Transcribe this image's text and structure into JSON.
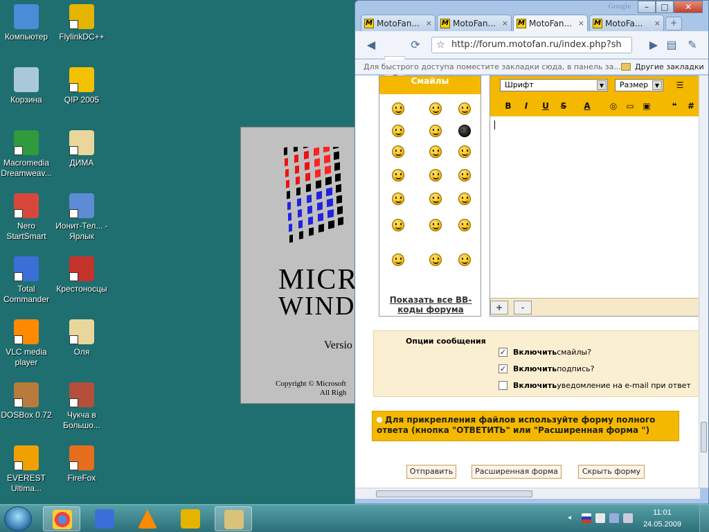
{
  "desktop": {
    "icons": [
      {
        "label": "Компьютер",
        "icon": "computer-icon",
        "color": "#4a8cd8"
      },
      {
        "label": "Корзина",
        "icon": "recycle-bin-icon",
        "color": "#a9c9d9"
      },
      {
        "label": "Macromedia Dreamweav...",
        "icon": "dreamweaver-icon",
        "color": "#2f9b3c"
      },
      {
        "label": "Nero StartSmart",
        "icon": "nero-icon",
        "color": "#d8473c"
      },
      {
        "label": "Total Commander",
        "icon": "floppy-icon",
        "color": "#3b6fd8"
      },
      {
        "label": "VLC media player",
        "icon": "vlc-cone-icon",
        "color": "#ff8a00"
      },
      {
        "label": "DOSBox 0.72",
        "icon": "dosbox-icon",
        "color": "#b97b3c"
      },
      {
        "label": "EVEREST Ultima...",
        "icon": "everest-icon",
        "color": "#f0a000"
      },
      {
        "label": "FlylinkDC++",
        "icon": "flylink-icon",
        "color": "#e4b400"
      },
      {
        "label": "QIP 2005",
        "icon": "qip-icon",
        "color": "#f2c200"
      },
      {
        "label": "ДИМА",
        "icon": "folder-icon",
        "color": "#e9d69a"
      },
      {
        "label": "Ионит-Тел... - Ярлык",
        "icon": "network-icon",
        "color": "#5d8bd4"
      },
      {
        "label": "Крестоносцы",
        "icon": "crusaders-icon",
        "color": "#c4322c"
      },
      {
        "label": "Оля",
        "icon": "folder-icon",
        "color": "#e9d69a"
      },
      {
        "label": "Чукча в Большо...",
        "icon": "game-icon",
        "color": "#b44f3a"
      },
      {
        "label": "FireFox",
        "icon": "firefox-icon",
        "color": "#e66d1b"
      }
    ]
  },
  "splash": {
    "brand_line1": "MICRO",
    "brand_line2": "WINDO",
    "version": "Versio",
    "copyright1": "Copyright © Microsoft",
    "copyright2": "All Righ"
  },
  "browser": {
    "corner_label": "Google",
    "window_buttons": {
      "minimize": "–",
      "maximize": "□",
      "close": "✕"
    },
    "tabs": [
      {
        "label": "MotoFan...",
        "active": false
      },
      {
        "label": "MotoFan...",
        "active": false
      },
      {
        "label": "MotoFan...",
        "active": true
      },
      {
        "label": "MotoFa...",
        "active": false
      }
    ],
    "favicon_letter": "M",
    "tab_close": "×",
    "new_tab": "+",
    "url": "http://forum.motofan.ru/index.php?sh",
    "bookmarks_hint": "Для быстрого доступа поместите закладки сюда, в панель за...",
    "other_bookmarks": "Другие закладки"
  },
  "page": {
    "smileys_title": "Смайлы",
    "show_all": "Показать все BB-коды форума",
    "font_select": "Шрифт",
    "size_select": "Размер",
    "format_buttons": [
      "B",
      "I",
      "U",
      "S",
      "A"
    ],
    "plus": "+",
    "minus": "-",
    "options_title": "Опции сообщения",
    "options": [
      {
        "bold": "Включить",
        "rest": " смайлы?",
        "checked": true
      },
      {
        "bold": "Включить",
        "rest": " подпись?",
        "checked": true
      },
      {
        "bold": "Включить",
        "rest": " уведомление на e-mail при ответ",
        "checked": false
      }
    ],
    "notice": "Для прикрепления файлов используйте форму полного ответа (кнопка \"ОТВЕТИТЬ\" или \"Расширенная форма \")",
    "buttons": {
      "send": "Отправить",
      "advanced": "Расширенная форма",
      "hide": "Скрыть форму"
    }
  },
  "taskbar": {
    "time": "11:01",
    "date": "24.05.2009"
  }
}
